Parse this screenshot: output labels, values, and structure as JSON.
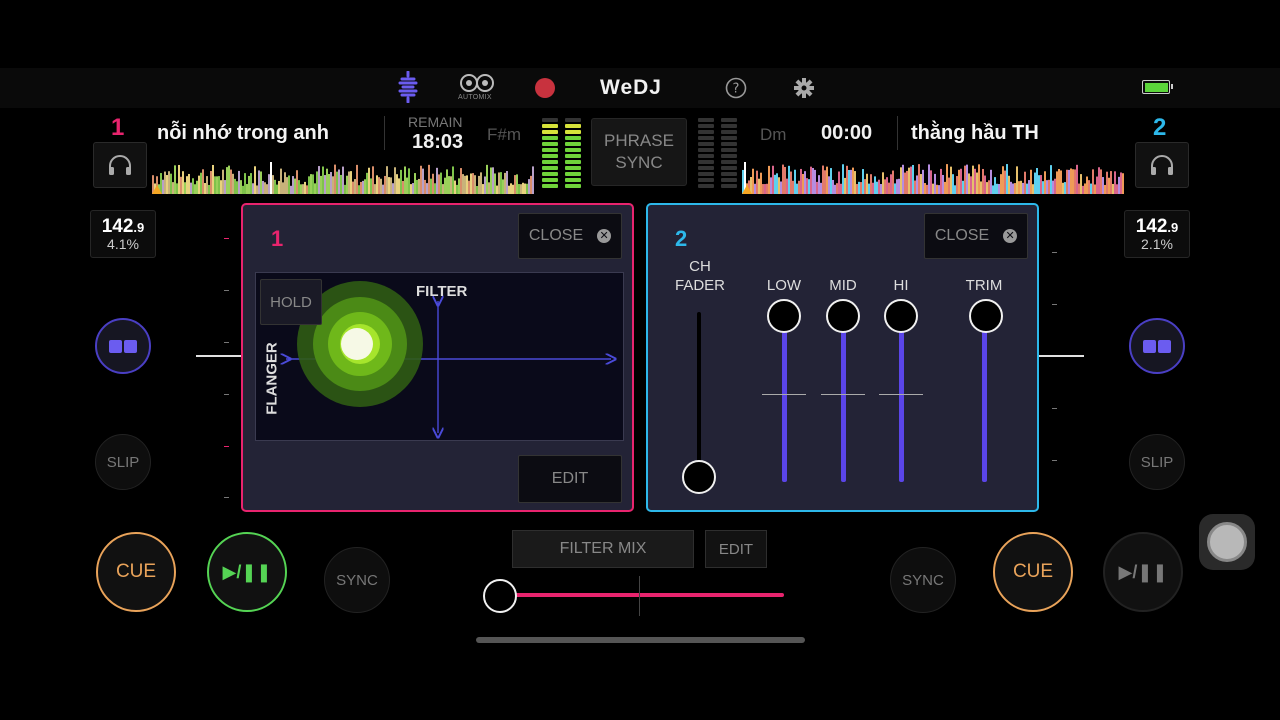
{
  "app": {
    "title": "WeDJ",
    "automix_label": "AUTOMIX"
  },
  "colors": {
    "deck1": "#e8246e",
    "deck2": "#2db8ea",
    "cue": "#e9a35a",
    "play": "#55d454",
    "eq": "#5a45e8"
  },
  "icons": {
    "waveform": "waveform-icon",
    "automix": "automix-icon",
    "record": "record-icon",
    "help": "help-icon",
    "settings": "gear-icon",
    "battery": "battery-icon",
    "headphones": "headphones-icon"
  },
  "deck1": {
    "number": "1",
    "title": "nỗi nhớ trong anh",
    "remain_label": "REMAIN",
    "time": "18:03",
    "key": "F#m",
    "bpm_main": "142",
    "bpm_decimal": ".9",
    "bpm_pct": "4.1%",
    "slip_label": "SLIP",
    "cue_label": "CUE",
    "sync_label": "SYNC",
    "play_label": "▶/❚❚"
  },
  "deck2": {
    "number": "2",
    "title": "thằng hầu TH",
    "key": "Dm",
    "time": "00:00",
    "bpm_main": "142",
    "bpm_decimal": ".9",
    "bpm_pct": "2.1%",
    "slip_label": "SLIP",
    "cue_label": "CUE",
    "sync_label": "SYNC",
    "play_label": "▶/❚❚"
  },
  "phrase_sync": {
    "line1": "PHRASE",
    "line2": "SYNC"
  },
  "panel1": {
    "number": "1",
    "close_label": "CLOSE",
    "hold_label": "HOLD",
    "x_axis_label": "FILTER",
    "y_axis_label": "FLANGER",
    "edit_label": "EDIT"
  },
  "panel2": {
    "number": "2",
    "close_label": "CLOSE",
    "ch_fader_line1": "CH",
    "ch_fader_line2": "FADER",
    "eq": [
      {
        "label": "LOW"
      },
      {
        "label": "MID"
      },
      {
        "label": "HI"
      },
      {
        "label": "TRIM"
      }
    ]
  },
  "mixer": {
    "filter_mix_label": "FILTER MIX",
    "edit_label": "EDIT"
  }
}
